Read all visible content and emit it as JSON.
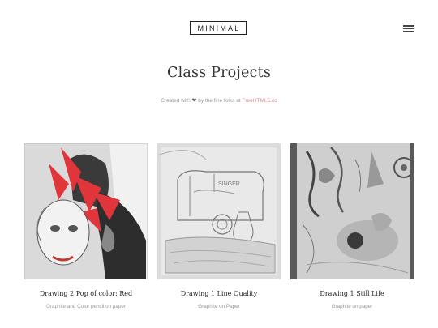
{
  "header": {
    "logo": "MINIMAL"
  },
  "hero": {
    "title": "Class Projects",
    "credit_prefix": "Created with",
    "credit_middle": "by the fine folks at",
    "credit_link": "FreeHTML5.co"
  },
  "cards": [
    {
      "title": "Drawing 2 Pop of color: Red",
      "subtitle": "Graphite and Color pencil on paper"
    },
    {
      "title": "Drawing 1 Line Quality",
      "subtitle": "Graphite on Paper"
    },
    {
      "title": "Drawing 1 Still Life",
      "subtitle": "Graphite on paper"
    }
  ],
  "colors": {
    "accent_link": "#e58a8a",
    "accent_red": "#e0353b"
  }
}
